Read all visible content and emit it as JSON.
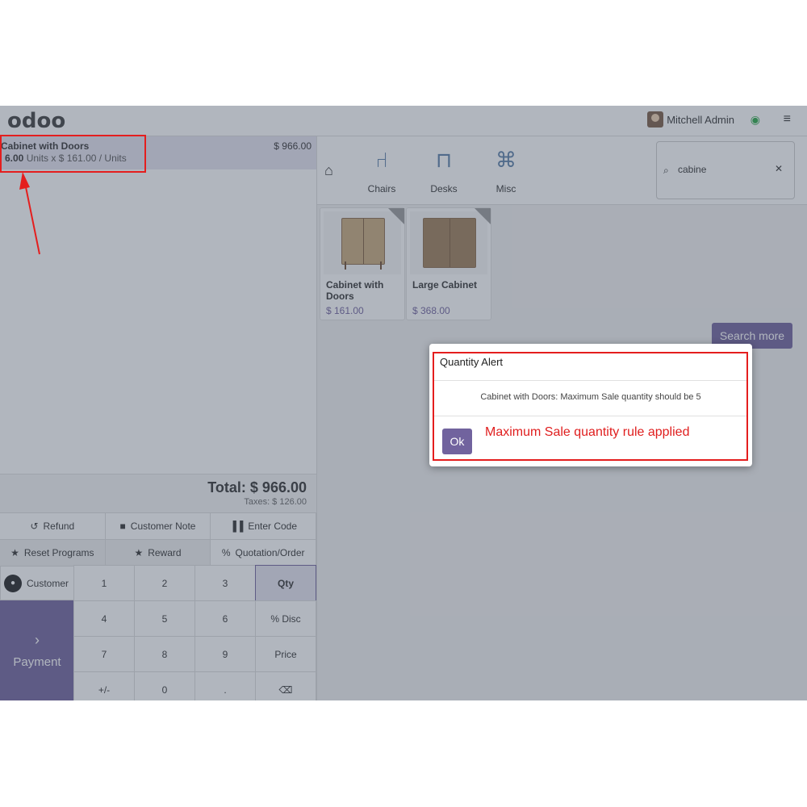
{
  "header": {
    "logo": "odoo",
    "user_name": "Mitchell Admin",
    "wifi_icon": "wifi-icon",
    "menu_icon": "hamburger-menu-icon"
  },
  "order": {
    "line": {
      "name": "Cabinet with Doors",
      "price": "$ 966.00",
      "qty": "6.00",
      "unit_detail": "Units x $ 161.00 / Units"
    },
    "total": "Total: $ 966.00",
    "taxes": "Taxes: $ 126.00"
  },
  "controls": {
    "refund": "Refund",
    "customer_note": "Customer Note",
    "enter_code": "Enter Code",
    "reset_programs": "Reset Programs",
    "reward": "Reward",
    "quotation_order": "Quotation/Order"
  },
  "numpad": {
    "customer": "Customer",
    "payment": "Payment",
    "keys": [
      "1",
      "2",
      "3",
      "Qty",
      "4",
      "5",
      "6",
      "% Disc",
      "7",
      "8",
      "9",
      "Price",
      "+/-",
      "0",
      ".",
      "⌫"
    ]
  },
  "categories": [
    {
      "label": "Chairs",
      "icon": "chair-icon"
    },
    {
      "label": "Desks",
      "icon": "desk-icon"
    },
    {
      "label": "Misc",
      "icon": "misc-icon"
    }
  ],
  "search": {
    "value": "cabine"
  },
  "products": [
    {
      "name": "Cabinet with Doors",
      "price": "$ 161.00"
    },
    {
      "name": "Large Cabinet",
      "price": "$ 368.00"
    }
  ],
  "search_more": "Search more",
  "modal": {
    "title": "Quantity Alert",
    "body": "Cabinet with Doors: Maximum Sale quantity should be 5",
    "ok": "Ok",
    "annotation": "Maximum Sale quantity rule applied"
  },
  "colors": {
    "accent": "#71639e",
    "annotation": "#e41e1e"
  }
}
